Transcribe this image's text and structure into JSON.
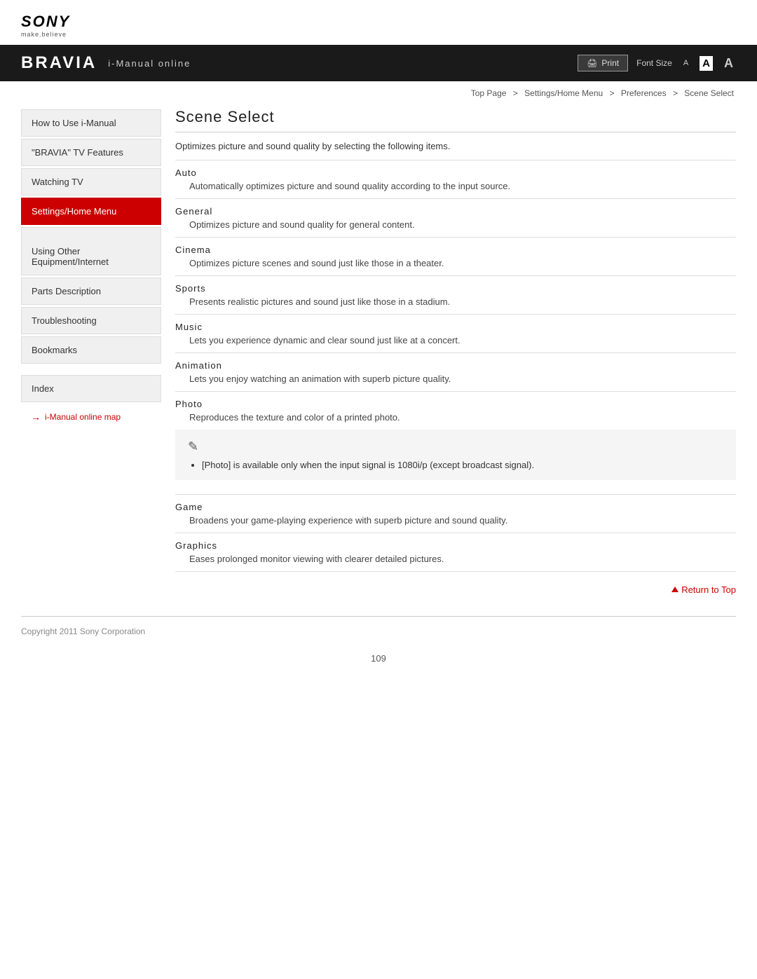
{
  "logo": {
    "text": "SONY",
    "tagline": "make.believe"
  },
  "banner": {
    "bravia": "BRAVIA",
    "subtitle": "i-Manual online",
    "print_label": "Print",
    "font_size_label": "Font Size",
    "font_sizes": [
      "A",
      "A",
      "A"
    ]
  },
  "breadcrumb": {
    "top_page": "Top Page",
    "separator": ">",
    "settings": "Settings/Home Menu",
    "preferences": "Preferences",
    "current": "Scene Select"
  },
  "sidebar": {
    "items": [
      {
        "id": "how-to-use",
        "label": "How to Use i-Manual"
      },
      {
        "id": "bravia-tv",
        "label": "\"BRAVIA\" TV Features"
      },
      {
        "id": "watching-tv",
        "label": "Watching TV"
      },
      {
        "id": "settings-home",
        "label": "Settings/Home Menu",
        "active": true
      },
      {
        "id": "using-other",
        "label": "Using Other\nEquipment/Internet"
      },
      {
        "id": "parts-desc",
        "label": "Parts Description"
      },
      {
        "id": "troubleshooting",
        "label": "Troubleshooting"
      },
      {
        "id": "bookmarks",
        "label": "Bookmarks"
      }
    ],
    "index_label": "Index",
    "map_link": "i-Manual online map"
  },
  "content": {
    "page_title": "Scene Select",
    "intro": "Optimizes picture and sound quality by selecting the following items.",
    "scenes": [
      {
        "term": "Auto",
        "desc": "Automatically optimizes picture and sound quality according to the input source."
      },
      {
        "term": "General",
        "desc": "Optimizes picture and sound quality for general content."
      },
      {
        "term": "Cinema",
        "desc": "Optimizes picture scenes and sound just like those in a theater."
      },
      {
        "term": "Sports",
        "desc": "Presents realistic pictures and sound just like those in a stadium."
      },
      {
        "term": "Music",
        "desc": "Lets you experience dynamic and clear sound just like at a concert."
      },
      {
        "term": "Animation",
        "desc": "Lets you enjoy watching an animation with superb picture quality."
      },
      {
        "term": "Photo",
        "desc": "Reproduces the texture and color of a printed photo."
      },
      {
        "term": "Game",
        "desc": "Broadens your game-playing experience with superb picture and sound quality."
      },
      {
        "term": "Graphics",
        "desc": "Eases prolonged monitor viewing with clearer detailed pictures."
      }
    ],
    "note": {
      "bullet": "[Photo] is available only when the input signal is 1080i/p (except broadcast signal)."
    },
    "return_top": "Return to Top"
  },
  "footer": {
    "copyright": "Copyright 2011 Sony Corporation",
    "page_number": "109"
  }
}
